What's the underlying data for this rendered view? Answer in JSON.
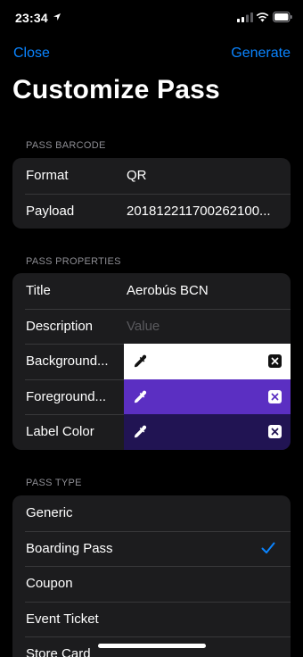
{
  "status": {
    "time": "23:34"
  },
  "nav": {
    "close": "Close",
    "generate": "Generate"
  },
  "title": "Customize Pass",
  "barcode": {
    "header": "PASS BARCODE",
    "rows": [
      {
        "label": "Format",
        "value": "QR"
      },
      {
        "label": "Payload",
        "value": "201812211700262100..."
      }
    ]
  },
  "properties": {
    "header": "PASS PROPERTIES",
    "title": {
      "label": "Title",
      "value": "Aerobús BCN"
    },
    "description": {
      "label": "Description",
      "placeholder": "Value"
    },
    "background": {
      "label": "Background...",
      "color": "#ffffff"
    },
    "foreground": {
      "label": "Foreground...",
      "color": "#5b2fc2"
    },
    "label_color": {
      "label": "Label Color",
      "color": "#211453"
    }
  },
  "pass_type": {
    "header": "PASS TYPE",
    "options": [
      "Generic",
      "Boarding Pass",
      "Coupon",
      "Event Ticket",
      "Store Card"
    ],
    "selected": "Boarding Pass"
  },
  "colors": {
    "accent": "#0a84ff",
    "background": "#000000",
    "cell": "#1c1c1e"
  }
}
